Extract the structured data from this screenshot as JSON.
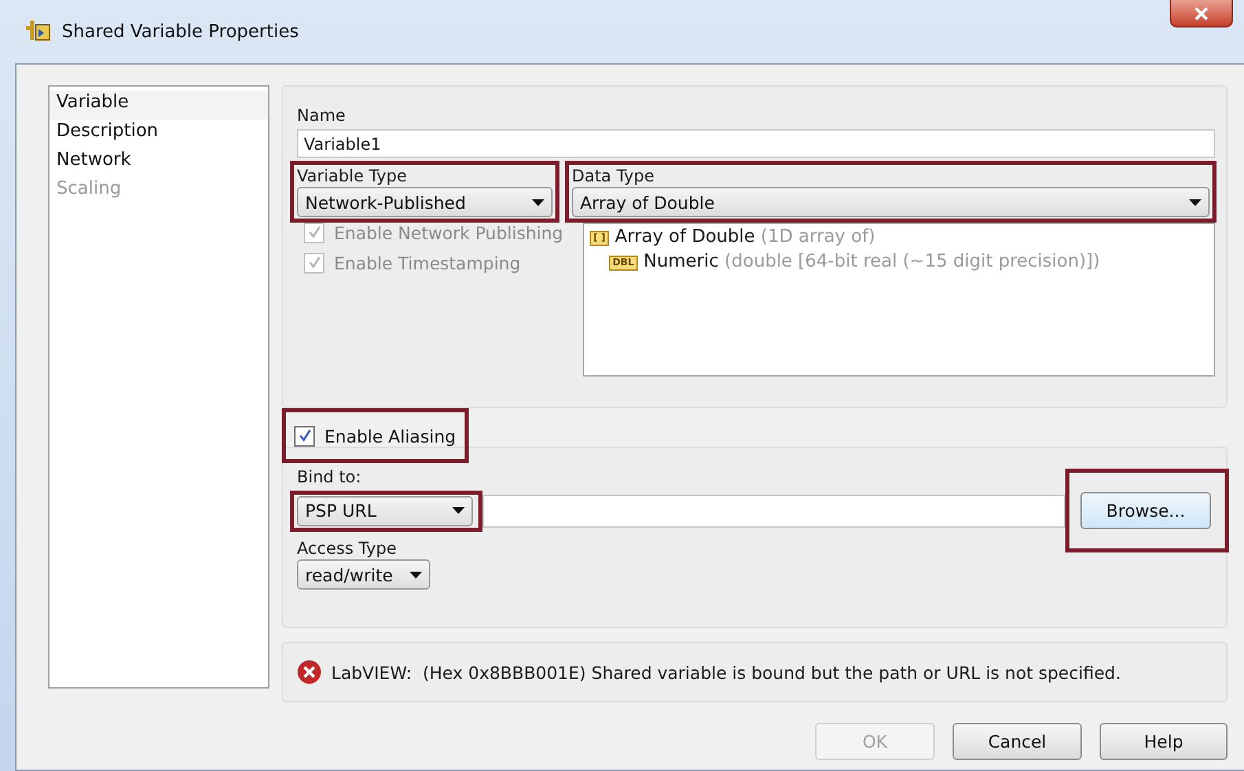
{
  "window": {
    "title": "Shared Variable Properties"
  },
  "sidebar": {
    "items": [
      {
        "label": "Variable",
        "selected": true,
        "disabled": false
      },
      {
        "label": "Description",
        "selected": false,
        "disabled": false
      },
      {
        "label": "Network",
        "selected": false,
        "disabled": false
      },
      {
        "label": "Scaling",
        "selected": false,
        "disabled": true
      }
    ]
  },
  "name": {
    "label": "Name",
    "value": "Variable1"
  },
  "variable_type": {
    "label": "Variable Type",
    "value": "Network-Published",
    "highlighted": true
  },
  "options": [
    {
      "label": "Enable Network Publishing",
      "checked": true,
      "disabled": true
    },
    {
      "label": "Enable Timestamping",
      "checked": true,
      "disabled": true
    }
  ],
  "data_type": {
    "label": "Data Type",
    "value": "Array of Double",
    "highlighted": true,
    "tree": [
      {
        "badge": "[ ]",
        "name": "Array of Double",
        "detail": "(1D array of)",
        "children": [
          {
            "badge": "DBL",
            "name": "Numeric",
            "detail": "(double [64-bit real (~15 digit precision)])"
          }
        ]
      }
    ]
  },
  "aliasing": {
    "label": "Enable Aliasing",
    "checked": true,
    "disabled": false,
    "highlighted": true
  },
  "bind_to": {
    "label": "Bind to:",
    "value": "PSP URL",
    "highlighted": true
  },
  "browse_button": {
    "label": "Browse...",
    "highlighted": true
  },
  "access_type": {
    "label": "Access Type",
    "value": "read/write"
  },
  "error": {
    "source": "LabVIEW:",
    "message": "(Hex 0x8BBB001E) Shared variable is bound but the path or URL is not specified."
  },
  "buttons": [
    {
      "label": "OK",
      "disabled": true
    },
    {
      "label": "Cancel",
      "disabled": false
    },
    {
      "label": "Help",
      "disabled": false
    }
  ]
}
